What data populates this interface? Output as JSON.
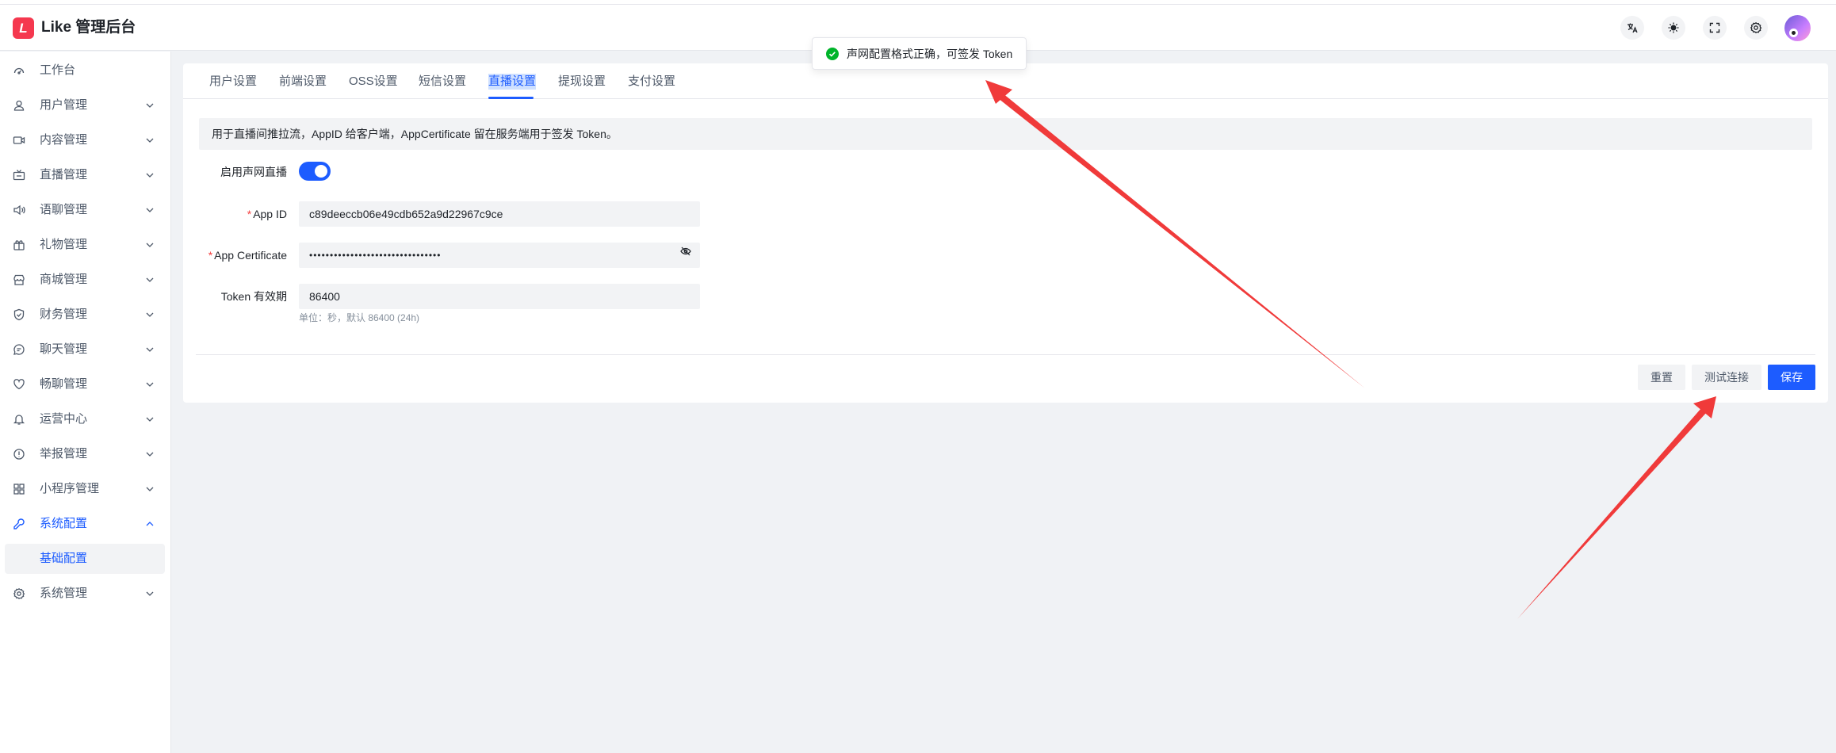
{
  "header": {
    "logo_letter": "L",
    "app_title": "Like 管理后台"
  },
  "sidebar": {
    "items": [
      {
        "label": "工作台",
        "icon": "dashboard-icon"
      },
      {
        "label": "用户管理",
        "icon": "user-icon"
      },
      {
        "label": "内容管理",
        "icon": "video-icon"
      },
      {
        "label": "直播管理",
        "icon": "live-icon"
      },
      {
        "label": "语聊管理",
        "icon": "speaker-icon"
      },
      {
        "label": "礼物管理",
        "icon": "gift-icon"
      },
      {
        "label": "商城管理",
        "icon": "shop-icon"
      },
      {
        "label": "财务管理",
        "icon": "shield-icon"
      },
      {
        "label": "聊天管理",
        "icon": "chat-icon"
      },
      {
        "label": "畅聊管理",
        "icon": "heart-icon"
      },
      {
        "label": "运营中心",
        "icon": "bell-icon"
      },
      {
        "label": "举报管理",
        "icon": "alert-icon"
      },
      {
        "label": "小程序管理",
        "icon": "apps-icon"
      },
      {
        "label": "系统配置",
        "icon": "wrench-icon"
      },
      {
        "label": "系统管理",
        "icon": "gear-icon"
      }
    ],
    "sub_item": "基础配置"
  },
  "tabs": [
    "用户设置",
    "前端设置",
    "OSS设置",
    "短信设置",
    "直播设置",
    "提现设置",
    "支付设置"
  ],
  "active_tab": "直播设置",
  "info": "用于直播间推拉流，AppID 给客户端，AppCertificate 留在服务端用于签发 Token。",
  "form": {
    "enable_label": "启用声网直播",
    "enable_value": true,
    "appid_label": "App ID",
    "appid_value": "c89deeccb06e49cdb652a9d22967c9ce",
    "cert_label": "App Certificate",
    "cert_value": "••••••••••••••••••••••••••••••••",
    "token_label": "Token 有效期",
    "token_value": "86400",
    "token_hint": "单位：秒，默认 86400 (24h)",
    "required_mark": "*"
  },
  "buttons": {
    "reset": "重置",
    "test": "测试连接",
    "save": "保存"
  },
  "toast": {
    "text": "声网配置格式正确，可签发 Token"
  },
  "colors": {
    "primary": "#1d5cff",
    "success": "#00b42a",
    "annotation_arrow": "#f03a3a",
    "logo": "#f5384f"
  }
}
